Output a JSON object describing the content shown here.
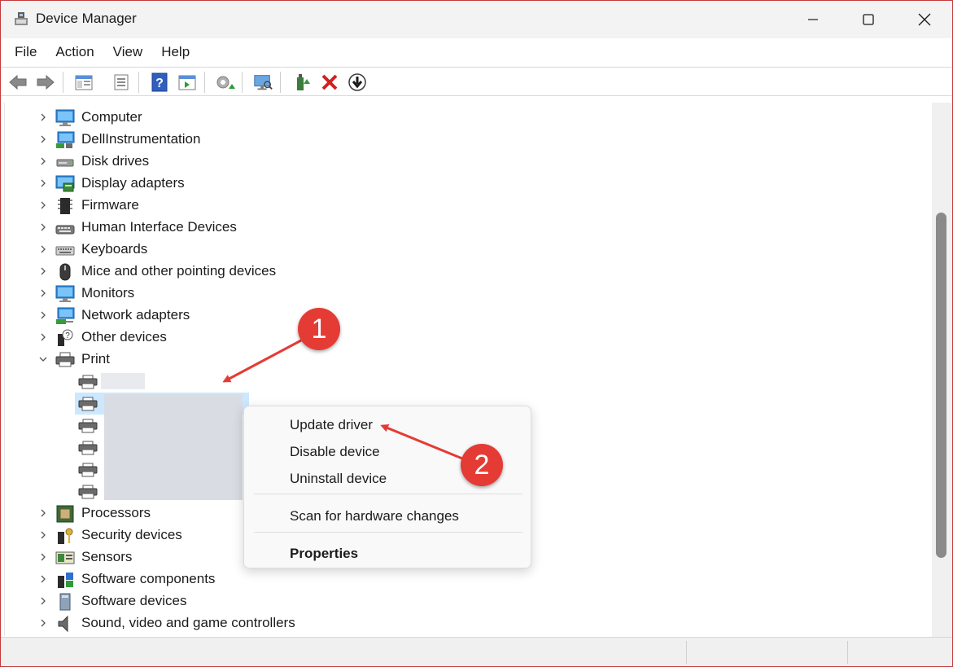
{
  "window": {
    "title": "Device Manager"
  },
  "menu": [
    "File",
    "Action",
    "View",
    "Help"
  ],
  "toolbar_icons": [
    "back-arrow-icon",
    "forward-arrow-icon",
    "show-hide-console-tree-icon",
    "properties-icon",
    "help-icon",
    "action-pane-icon",
    "update-driver-icon",
    "scan-hardware-icon",
    "enable-device-icon",
    "uninstall-icon",
    "disable-device-icon"
  ],
  "tree": {
    "categories_top": [
      {
        "label": "Computer",
        "icon": "computer-icon"
      },
      {
        "label": "DellInstrumentation",
        "icon": "network-computer-icon"
      },
      {
        "label": "Disk drives",
        "icon": "disk-drive-icon"
      },
      {
        "label": "Display adapters",
        "icon": "display-adapter-icon"
      },
      {
        "label": "Firmware",
        "icon": "firmware-chip-icon"
      },
      {
        "label": "Human Interface Devices",
        "icon": "hid-icon"
      },
      {
        "label": "Keyboards",
        "icon": "keyboard-icon"
      },
      {
        "label": "Mice and other pointing devices",
        "icon": "mouse-icon"
      },
      {
        "label": "Monitors",
        "icon": "monitor-icon"
      },
      {
        "label": "Network adapters",
        "icon": "network-adapter-icon"
      },
      {
        "label": "Other devices",
        "icon": "unknown-device-icon"
      },
      {
        "label": "Print",
        "icon": "printer-icon"
      }
    ],
    "categories_bottom": [
      {
        "label": "Processors",
        "icon": "processor-icon"
      },
      {
        "label": "Security devices",
        "icon": "security-key-icon"
      },
      {
        "label": "Sensors",
        "icon": "sensor-icon"
      },
      {
        "label": "Software components",
        "icon": "software-component-icon"
      },
      {
        "label": "Software devices",
        "icon": "software-device-icon"
      },
      {
        "label": "Sound, video and game controllers",
        "icon": "speaker-icon"
      }
    ]
  },
  "context_menu": {
    "update_driver": "Update driver",
    "disable_device": "Disable device",
    "uninstall_device": "Uninstall device",
    "scan_hardware": "Scan for hardware changes",
    "properties": "Properties"
  },
  "annotations": {
    "badge1": "1",
    "badge2": "2"
  },
  "colors": {
    "accent_red": "#e53b35",
    "selection_blue": "#cce8ff"
  }
}
